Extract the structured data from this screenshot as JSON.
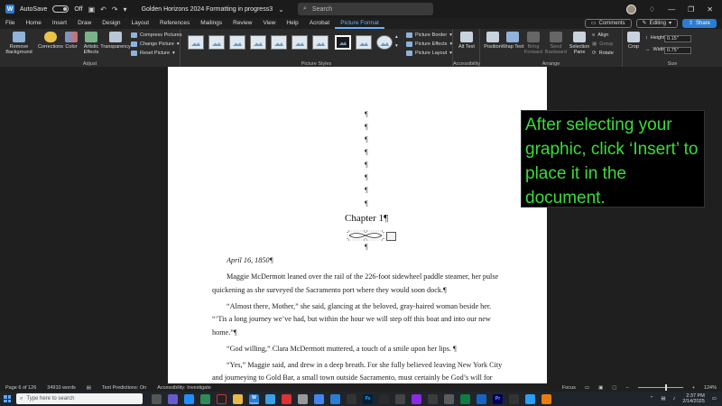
{
  "titlebar": {
    "autosave_label": "AutoSave",
    "autosave_state": "Off",
    "doc_title": "Golden Horizons 2024 Formatting in progress3",
    "search_placeholder": "Search"
  },
  "tabs": [
    "File",
    "Home",
    "Insert",
    "Draw",
    "Design",
    "Layout",
    "References",
    "Mailings",
    "Review",
    "View",
    "Help",
    "Acrobat",
    "Picture Format"
  ],
  "active_tab": "Picture Format",
  "tab_actions": {
    "comments": "Comments",
    "editing": "Editing",
    "share": "Share"
  },
  "ribbon": {
    "adjust": {
      "label": "Adjust",
      "remove_background": "Remove Background",
      "corrections": "Corrections",
      "color": "Color",
      "artistic_effects": "Artistic Effects",
      "transparency": "Transparency",
      "compress": "Compress Pictures",
      "change": "Change Picture",
      "reset": "Reset Picture"
    },
    "styles": {
      "label": "Picture Styles",
      "border": "Picture Border",
      "effects": "Picture Effects",
      "layout": "Picture Layout"
    },
    "accessibility": {
      "label": "Accessibility",
      "alt_text": "Alt Text"
    },
    "arrange": {
      "label": "Arrange",
      "position": "Position",
      "wrap_text": "Wrap Text",
      "bring_forward": "Bring Forward",
      "send_backward": "Send Backward",
      "selection_pane": "Selection Pane",
      "align": "Align",
      "group": "Group",
      "rotate": "Rotate"
    },
    "size": {
      "label": "Size",
      "crop": "Crop",
      "height_label": "Height:",
      "height_value": "0.15\"",
      "width_label": "Width:",
      "width_value": "0.75\""
    }
  },
  "document": {
    "pilcrow": "¶",
    "chapter": "Chapter 1¶",
    "date_line": "April 16, 1850¶",
    "lines": [
      "Maggie McDermott leaned over the rail of the 226-foot sidewheel paddle steamer, her pulse",
      "quickening as she surveyed the Sacramento port where they would soon dock.¶",
      "“Almost there, Mother,” she said, glancing at the beloved, gray-haired woman beside her.",
      "“’Tis a long journey we’ve had, but within the hour we will step off this boat and into our new",
      "home.”¶",
      "“God willing,” Clara McDermott muttered, a touch of a smile upon her lips. ¶",
      "“Yes,” Maggie said, and drew in a deep breath. For she fully believed leaving New York City",
      "and journeying to Gold Bar, a small town outside Sacramento, must certainly be God’s will for"
    ]
  },
  "callout": {
    "text": "After selecting your graphic, click ‘Insert’ to place it in the document."
  },
  "statusbar": {
    "page": "Page 6 of 126",
    "words": "34910 words",
    "predictions": "Text Predictions: On",
    "accessibility": "Accessibility: Investigate",
    "focus": "Focus",
    "zoom": "124%"
  },
  "taskbar": {
    "search_placeholder": "Type here to search",
    "time": "2:37 PM",
    "date": "2/14/2025"
  },
  "colors": {
    "accent": "#2b7cd3",
    "callout_text": "#3bdc3b"
  }
}
